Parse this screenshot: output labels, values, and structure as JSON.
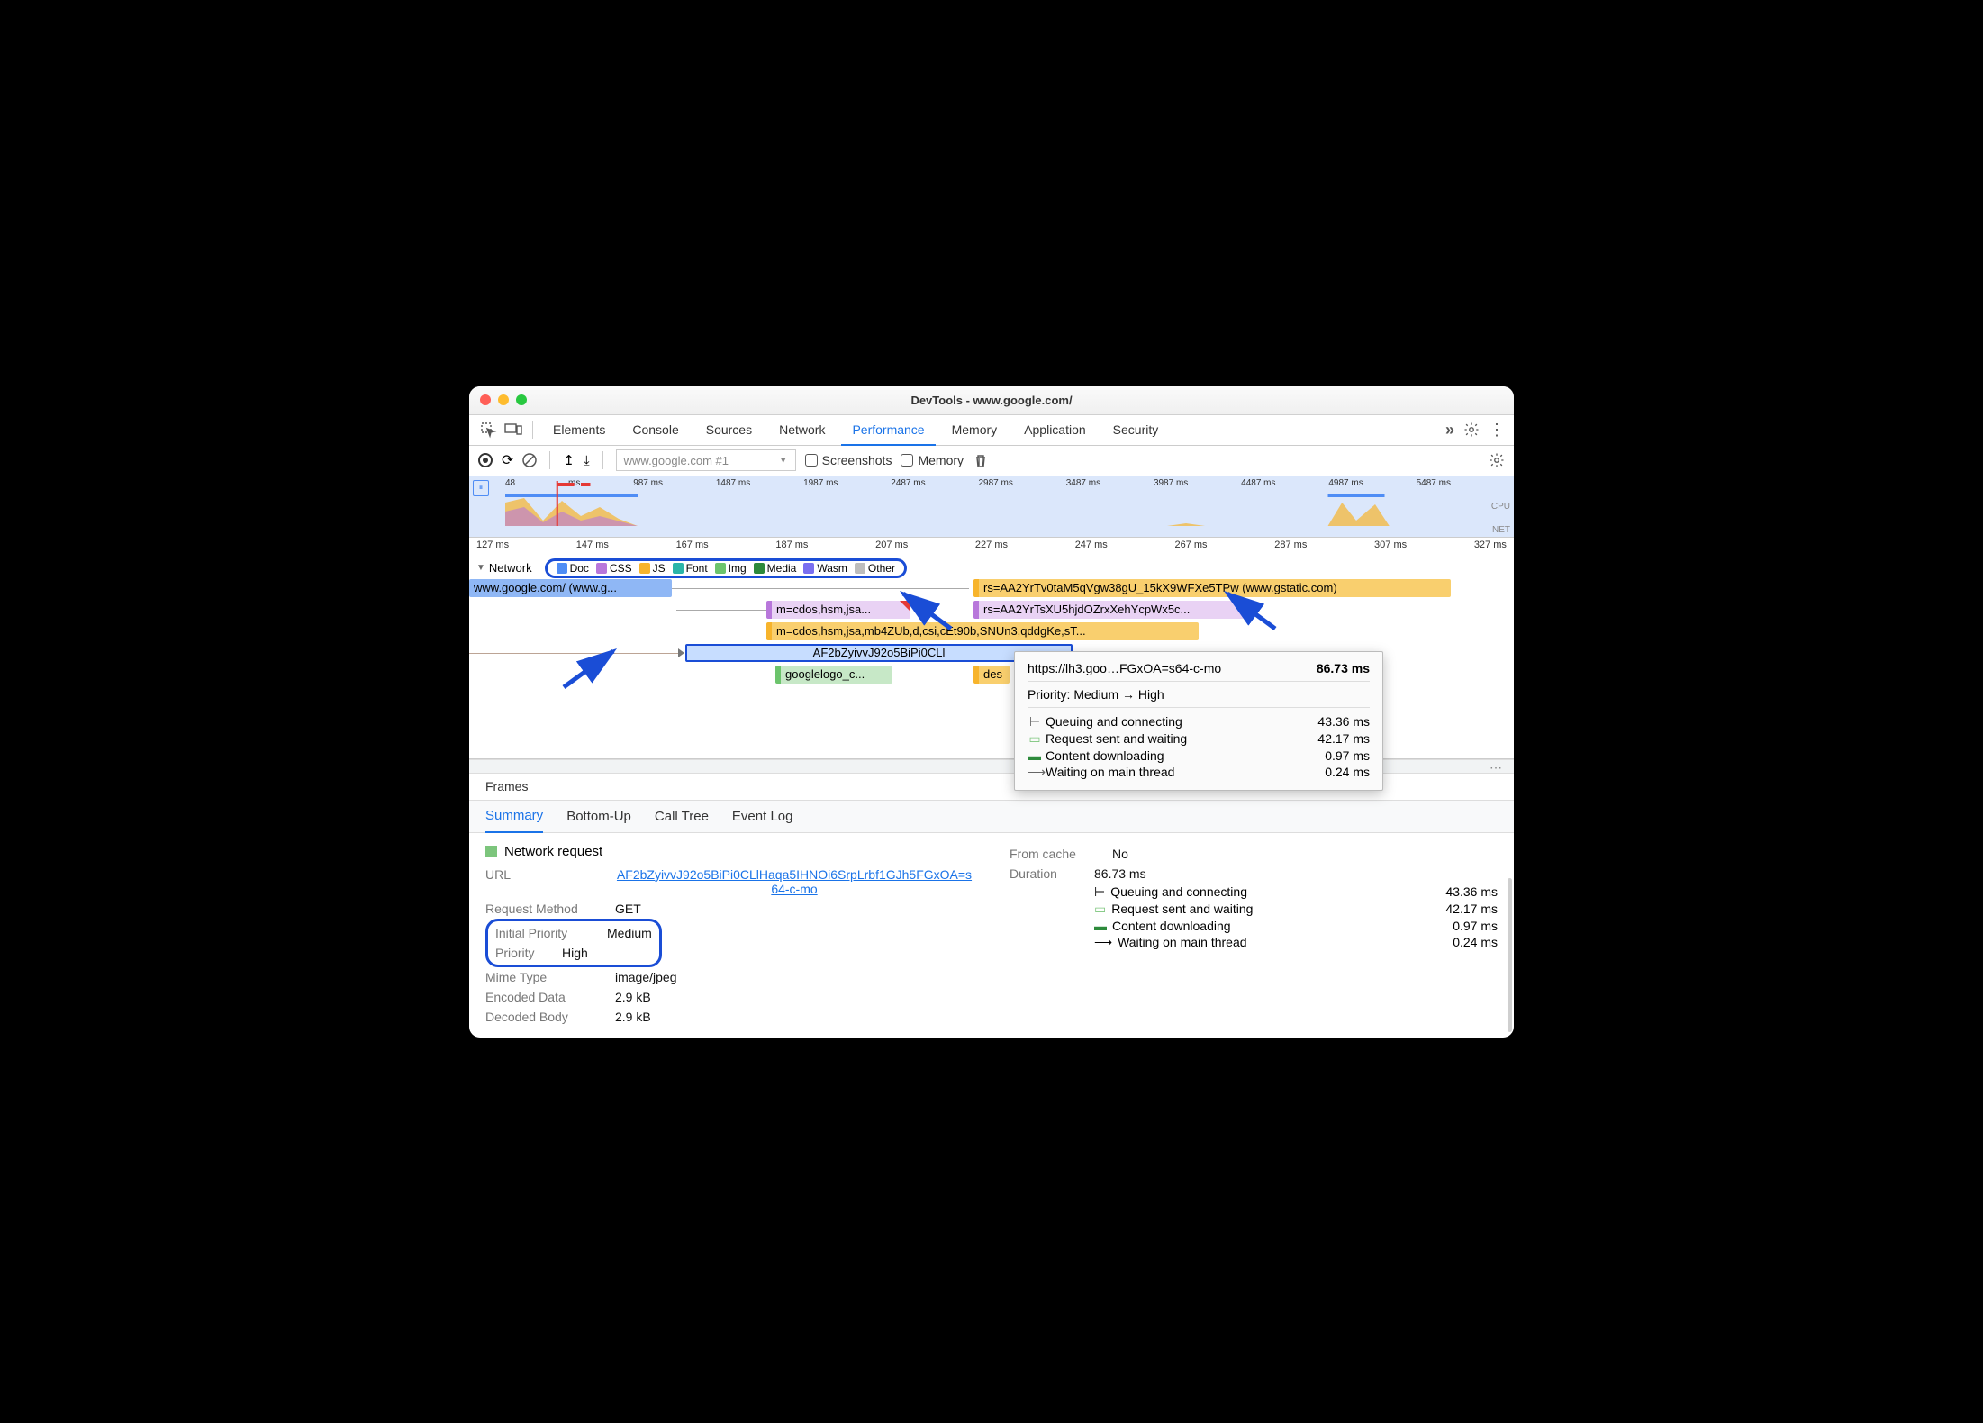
{
  "window": {
    "title": "DevTools - www.google.com/"
  },
  "tabs": [
    "Elements",
    "Console",
    "Sources",
    "Network",
    "Performance",
    "Memory",
    "Application",
    "Security"
  ],
  "activeTab": "Performance",
  "toolbar": {
    "recording_url": "www.google.com #1",
    "screenshots": "Screenshots",
    "memory": "Memory"
  },
  "overview_ticks": [
    "48",
    "ms",
    "987 ms",
    "1487 ms",
    "1987 ms",
    "2487 ms",
    "2987 ms",
    "3487 ms",
    "3987 ms",
    "4487 ms",
    "4987 ms",
    "5487 ms"
  ],
  "overview_labels": {
    "cpu": "CPU",
    "net": "NET"
  },
  "ruler_ticks": [
    "127 ms",
    "147 ms",
    "167 ms",
    "187 ms",
    "207 ms",
    "227 ms",
    "247 ms",
    "267 ms",
    "287 ms",
    "307 ms",
    "327 ms"
  ],
  "network_label": "Network",
  "legend": [
    {
      "name": "Doc",
      "color": "#4f8df5"
    },
    {
      "name": "CSS",
      "color": "#b877db"
    },
    {
      "name": "JS",
      "color": "#f7b42c"
    },
    {
      "name": "Font",
      "color": "#2bb5a9"
    },
    {
      "name": "Img",
      "color": "#6cc46c"
    },
    {
      "name": "Media",
      "color": "#2d8a3b"
    },
    {
      "name": "Wasm",
      "color": "#7a6ff0"
    },
    {
      "name": "Other",
      "color": "#bdbdbd"
    }
  ],
  "bars": {
    "root": "www.google.com/ (www.g...",
    "rs1": "rs=AA2YrTv0taM5qVgw38gU_15kX9WFXe5TPw (www.gstatic.com)",
    "rs2": "rs=AA2YrTsXU5hjdOZrxXehYcpWx5c...",
    "m1": "m=cdos,hsm,jsa...",
    "m2": "m=cdos,hsm,jsa,mb4ZUb,d,csi,cEt90b,SNUn3,qddgKe,sT...",
    "sel": "AF2bZyivvJ92o5BiPi0CLl",
    "logo": "googlelogo_c...",
    "des": "des"
  },
  "tooltip": {
    "url": "https://lh3.goo…FGxOA=s64-c-mo",
    "total": "86.73 ms",
    "priority": "Priority: Medium → High",
    "rows": [
      {
        "icon": "⊢",
        "label": "Queuing and connecting",
        "val": "43.36 ms"
      },
      {
        "icon": "▭",
        "label": "Request sent and waiting",
        "val": "42.17 ms",
        "iconcolor": "#7cc57c"
      },
      {
        "icon": "▬",
        "label": "Content downloading",
        "val": "0.97 ms",
        "iconcolor": "#2d8a3b"
      },
      {
        "icon": "⟶",
        "label": "Waiting on main thread",
        "val": "0.24 ms"
      }
    ]
  },
  "frames_label": "Frames",
  "subtabs": [
    "Summary",
    "Bottom-Up",
    "Call Tree",
    "Event Log"
  ],
  "activeSubtab": "Summary",
  "details": {
    "header": "Network request",
    "url_label": "URL",
    "url": "AF2bZyivvJ92o5BiPi0CLlHaqa5IHNOi6SrpLrbf1GJh5FGxOA=s64-c-mo",
    "method_label": "Request Method",
    "method": "GET",
    "initprio_label": "Initial Priority",
    "initprio": "Medium",
    "prio_label": "Priority",
    "prio": "High",
    "mime_label": "Mime Type",
    "mime": "image/jpeg",
    "enc_label": "Encoded Data",
    "enc": "2.9 kB",
    "dec_label": "Decoded Body",
    "dec": "2.9 kB",
    "fromcache_label": "From cache",
    "fromcache": "No",
    "duration_label": "Duration",
    "duration": "86.73 ms",
    "dur_rows": [
      {
        "icon": "⊢",
        "label": "Queuing and connecting",
        "val": "43.36 ms"
      },
      {
        "icon": "▭",
        "label": "Request sent and waiting",
        "val": "42.17 ms",
        "iconcolor": "#7cc57c"
      },
      {
        "icon": "▬",
        "label": "Content downloading",
        "val": "0.97 ms",
        "iconcolor": "#2d8a3b"
      },
      {
        "icon": "⟶",
        "label": "Waiting on main thread",
        "val": "0.24 ms"
      }
    ]
  }
}
